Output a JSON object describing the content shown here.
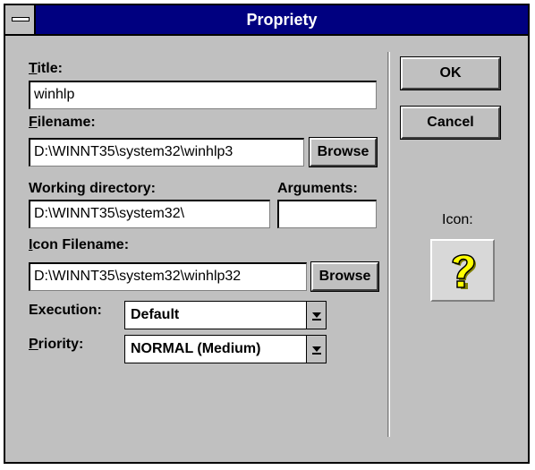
{
  "window": {
    "title": "Propriety"
  },
  "fields": {
    "title_label_key": "T",
    "title_label_rest": "itle:",
    "title_value": "winhlp",
    "filename_label_key": "F",
    "filename_label_rest": "ilename:",
    "filename_value": "D:\\WINNT35\\system32\\winhlp3",
    "working_dir_label": "Working directory:",
    "working_dir_value": "D:\\WINNT35\\system32\\",
    "arguments_label": "Arguments:",
    "arguments_value": "",
    "icon_filename_label_key": "I",
    "icon_filename_label_rest": "con Filename:",
    "icon_filename_value": "D:\\WINNT35\\system32\\winhlp32",
    "execution_label": "Execution:",
    "execution_value": "Default",
    "priority_label_key": "P",
    "priority_label_rest": "riority:",
    "priority_value": "NORMAL (Medium)"
  },
  "buttons": {
    "browse_label": "Browse",
    "ok_label": "OK",
    "cancel_label": "Cancel"
  },
  "icon": {
    "label": "Icon:",
    "name": "help-question-icon"
  },
  "colors": {
    "titlebar": "#000080",
    "face": "#c0c0c0",
    "icon_yellow": "#ffff00"
  }
}
